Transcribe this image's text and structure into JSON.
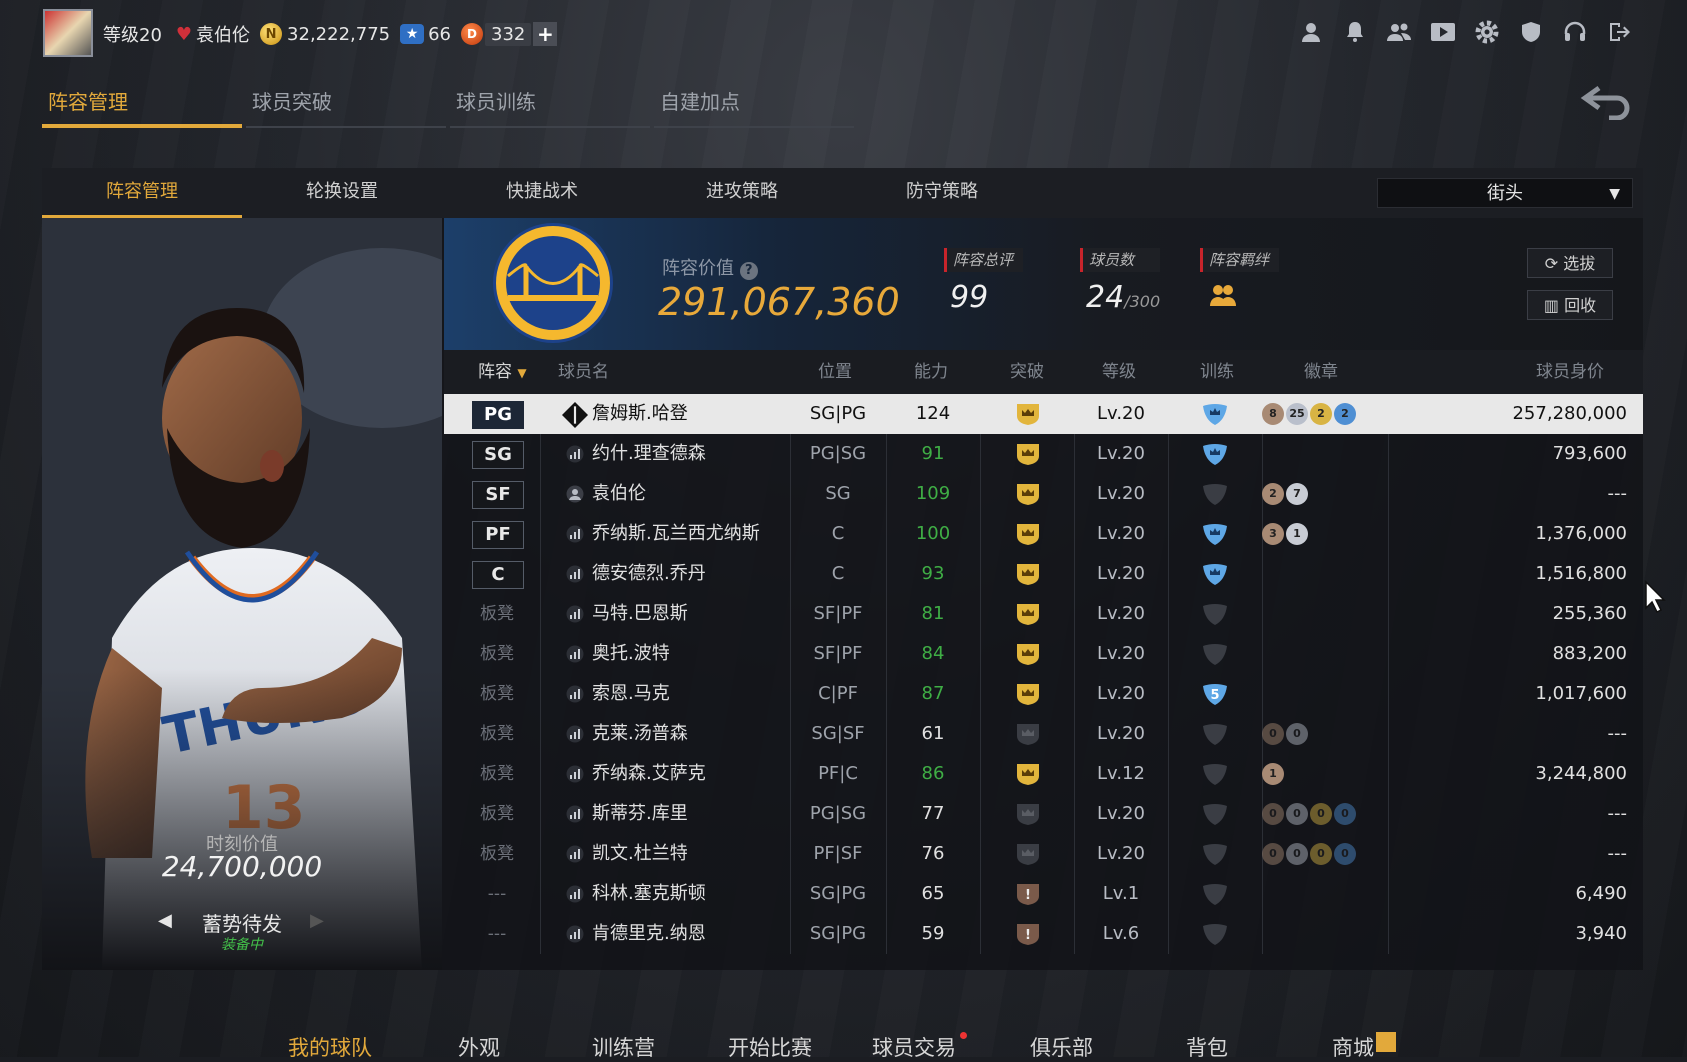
{
  "topbar": {
    "level": "等级20",
    "username": "袁伯伦",
    "coins": "32,222,775",
    "stars": "66",
    "d_points": "332",
    "d_icon_letter": "D",
    "plus": "+",
    "icons": [
      "user-icon",
      "bell-icon",
      "friends-icon",
      "video-icon",
      "gear-icon",
      "shield-icon",
      "headset-icon",
      "logout-icon"
    ]
  },
  "main_tabs": [
    "阵容管理",
    "球员突破",
    "球员训练",
    "自建加点"
  ],
  "sub_tabs": [
    "阵容管理",
    "轮换设置",
    "快捷战术",
    "进攻策略",
    "防守策略"
  ],
  "mode_select": "街头",
  "player_card": {
    "value_label": "时刻价值",
    "value": "24,700,000",
    "skill": "蓄势待发",
    "equip_status": "装备中"
  },
  "lineup_info": {
    "value_label": "阵容价值",
    "value": "291,067,360",
    "overall_label": "阵容总评",
    "overall": "99",
    "count_label": "球员数",
    "count": "24",
    "count_max": "/300",
    "bond_label": "阵容羁绊",
    "btn_select": "选拔",
    "btn_recycle": "回收"
  },
  "table": {
    "headers": [
      "阵容",
      "球员名",
      "位置",
      "能力",
      "突破",
      "等级",
      "训练",
      "徽章",
      "球员身价"
    ],
    "rows": [
      {
        "slot": "PG",
        "name": "詹姆斯.哈登",
        "pos": "SG|PG",
        "ovr": "124",
        "ovr_green": false,
        "level": "Lv.20",
        "value": "257,280,000",
        "badges": [
          "8",
          "25",
          "2",
          "2"
        ]
      },
      {
        "slot": "SG",
        "name": "约什.理查德森",
        "pos": "PG|SG",
        "ovr": "91",
        "ovr_green": true,
        "level": "Lv.20",
        "value": "793,600",
        "badges": []
      },
      {
        "slot": "SF",
        "name": "袁伯伦",
        "pos": "SG",
        "ovr": "109",
        "ovr_green": true,
        "level": "Lv.20",
        "value": "---",
        "badges": [
          "2",
          "7"
        ]
      },
      {
        "slot": "PF",
        "name": "乔纳斯.瓦兰西尤纳斯",
        "pos": "C",
        "ovr": "100",
        "ovr_green": true,
        "level": "Lv.20",
        "value": "1,376,000",
        "badges": [
          "3",
          "1"
        ]
      },
      {
        "slot": "C",
        "name": "德安德烈.乔丹",
        "pos": "C",
        "ovr": "93",
        "ovr_green": true,
        "level": "Lv.20",
        "value": "1,516,800",
        "badges": []
      },
      {
        "slot": "板凳",
        "name": "马特.巴恩斯",
        "pos": "SF|PF",
        "ovr": "81",
        "ovr_green": true,
        "level": "Lv.20",
        "value": "255,360",
        "badges": []
      },
      {
        "slot": "板凳",
        "name": "奥托.波特",
        "pos": "SF|PF",
        "ovr": "84",
        "ovr_green": true,
        "level": "Lv.20",
        "value": "883,200",
        "badges": []
      },
      {
        "slot": "板凳",
        "name": "索恩.马克",
        "pos": "C|PF",
        "ovr": "87",
        "ovr_green": true,
        "level": "Lv.20",
        "value": "1,017,600",
        "badges": [],
        "train": "5"
      },
      {
        "slot": "板凳",
        "name": "克莱.汤普森",
        "pos": "SG|SF",
        "ovr": "61",
        "ovr_green": false,
        "level": "Lv.20",
        "value": "---",
        "badges": [
          "0",
          "0"
        ]
      },
      {
        "slot": "板凳",
        "name": "乔纳森.艾萨克",
        "pos": "PF|C",
        "ovr": "86",
        "ovr_green": true,
        "level": "Lv.12",
        "value": "3,244,800",
        "badges": [
          "1"
        ]
      },
      {
        "slot": "板凳",
        "name": "斯蒂芬.库里",
        "pos": "PG|SG",
        "ovr": "77",
        "ovr_green": false,
        "level": "Lv.20",
        "value": "---",
        "badges": [
          "0",
          "0",
          "0",
          "0"
        ]
      },
      {
        "slot": "板凳",
        "name": "凯文.杜兰特",
        "pos": "PF|SF",
        "ovr": "76",
        "ovr_green": false,
        "level": "Lv.20",
        "value": "---",
        "badges": [
          "0",
          "0",
          "0",
          "0"
        ]
      },
      {
        "slot": "---",
        "name": "科林.塞克斯顿",
        "pos": "SG|PG",
        "ovr": "65",
        "ovr_green": false,
        "level": "Lv.1",
        "value": "6,490",
        "badges": [],
        "break_mark": "!"
      },
      {
        "slot": "---",
        "name": "肯德里克.纳恩",
        "pos": "SG|PG",
        "ovr": "59",
        "ovr_green": false,
        "level": "Lv.6",
        "value": "3,940",
        "badges": [],
        "break_mark": "!"
      }
    ]
  },
  "bottom_nav": [
    "我的球队",
    "外观",
    "训练营",
    "开始比赛",
    "球员交易",
    "俱乐部",
    "背包",
    "商城"
  ],
  "colors": {
    "accent": "#e2a93b",
    "green": "#3fae45",
    "red": "#c8242b"
  }
}
